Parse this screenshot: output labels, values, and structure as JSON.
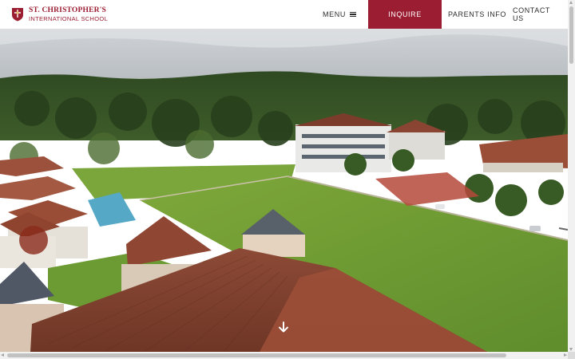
{
  "header": {
    "logo": {
      "name_line1": "ST. CHRISTOPHER'S",
      "name_line2": "INTERNATIONAL SCHOOL",
      "crest_icon": "school-crest-icon"
    },
    "nav": {
      "menu_label": "MENU",
      "menu_icon": "hamburger-icon",
      "inquire_label": "INQUIRE",
      "parents_info_label": "PARENTS INFO",
      "contact_us_label": "CONTACT US"
    }
  },
  "hero": {
    "image": "aerial-campus-photo",
    "scroll_icon": "arrow-down-icon"
  },
  "colors": {
    "brand": "#9b1d32",
    "nav_text": "#2c2c2c",
    "header_bg": "#ffffff"
  }
}
